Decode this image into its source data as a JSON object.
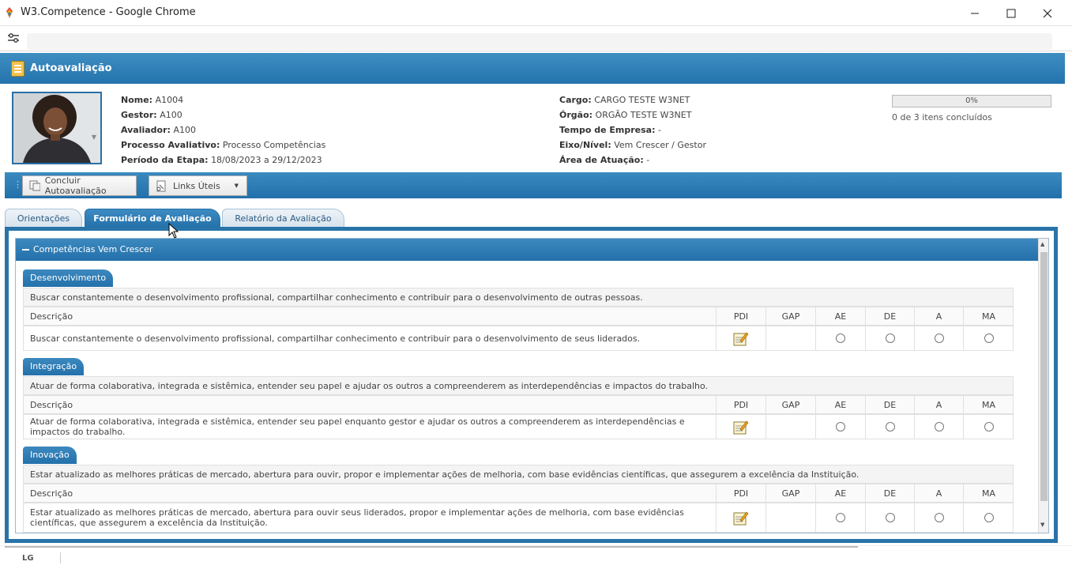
{
  "window": {
    "title": "W3.Competence - Google Chrome"
  },
  "header": {
    "title": "Autoavaliação"
  },
  "profile": {
    "left_fields": [
      {
        "label": "Nome:",
        "value": "A1004"
      },
      {
        "label": "Gestor:",
        "value": "A100"
      },
      {
        "label": "Avaliador:",
        "value": "A100"
      },
      {
        "label": "Processo Avaliativo:",
        "value": "Processo Competências"
      },
      {
        "label": "Período da Etapa:",
        "value": "18/08/2023 a 29/12/2023"
      }
    ],
    "right_fields": [
      {
        "label": "Cargo:",
        "value": "CARGO TESTE W3NET"
      },
      {
        "label": "Órgão:",
        "value": "ORGÃO TESTE W3NET"
      },
      {
        "label": "Tempo de Empresa:",
        "value": "-"
      },
      {
        "label": "Eixo/Nível:",
        "value": "Vem Crescer / Gestor"
      },
      {
        "label": "Área de Atuação:",
        "value": "-"
      }
    ],
    "progress_label": "0%",
    "progress_fraction": 0,
    "progress_text": "0 de 3 itens concluídos"
  },
  "toolbar": {
    "conclude_label": "Concluir Autoavaliação",
    "links_label": "Links Úteis"
  },
  "tabs": [
    {
      "label": "Orientações",
      "active": false
    },
    {
      "label": "Formulário de Avaliação",
      "active": true
    },
    {
      "label": "Relatório da Avaliação",
      "active": false
    }
  ],
  "panel": {
    "title": "Competências Vem Crescer"
  },
  "columns": {
    "desc": "Descrição",
    "pdi": "PDI",
    "gap": "GAP",
    "ae": "AE",
    "de": "DE",
    "a": "A",
    "ma": "MA"
  },
  "competencies": [
    {
      "name": "Desenvolvimento",
      "summary": "Buscar constantemente o desenvolvimento profissional, compartilhar conhecimento e contribuir para o desenvolvimento de outras pessoas.",
      "item": "Buscar constantemente o desenvolvimento profissional, compartilhar conhecimento e contribuir para o desenvolvimento de seus liderados."
    },
    {
      "name": "Integração",
      "summary": "Atuar de forma colaborativa, integrada e sistêmica, entender seu papel e ajudar os outros a compreenderem as interdependências e impactos do trabalho.",
      "item": "Atuar de forma colaborativa, integrada e sistêmica, entender seu papel enquanto gestor e ajudar os outros a compreenderem as interdependências e impactos do trabalho."
    },
    {
      "name": "Inovação",
      "summary": "Estar atualizado as melhores práticas de mercado, abertura para ouvir, propor e implementar ações de melhoria, com base evidências científicas, que assegurem a excelência da Instituição.",
      "item": "Estar atualizado as melhores práticas de mercado, abertura para ouvir seus liderados, propor e implementar ações de melhoria, com base evidências científicas, que assegurem a excelência da Instituição."
    }
  ],
  "footer": {
    "logo": "LG"
  }
}
